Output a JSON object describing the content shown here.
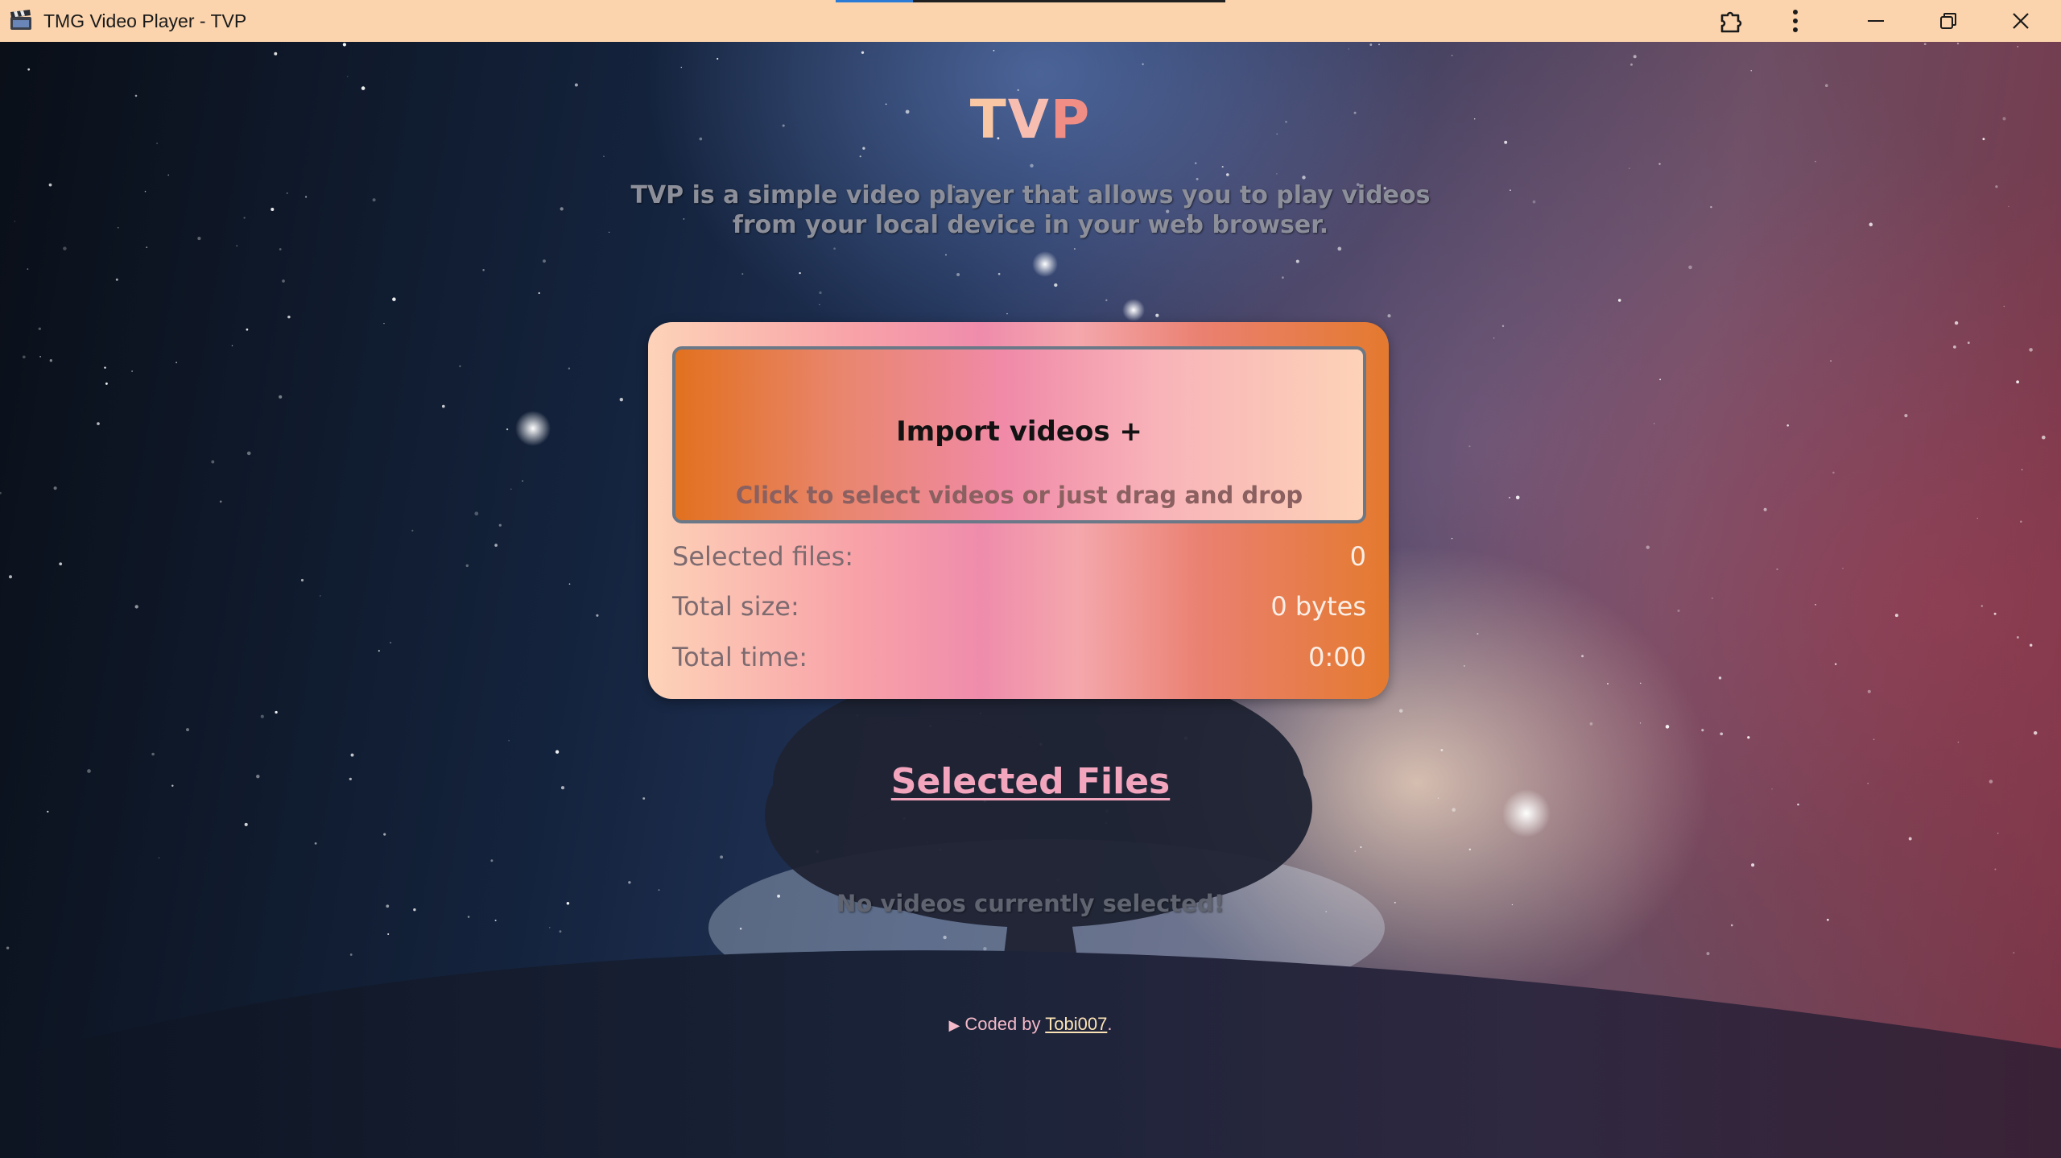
{
  "window": {
    "title": "TMG Video Player - TVP",
    "icon": "clapperboard-icon",
    "controls": [
      "extensions-icon",
      "more-vertical-icon",
      "minimize-icon",
      "restore-icon",
      "close-icon"
    ]
  },
  "header": {
    "title_parts": [
      "T",
      "V",
      "P"
    ],
    "description": "TVP is a simple video player that allows you to play videos from your local device in your web browser."
  },
  "import_card": {
    "button_label": "Import videos +",
    "hint": "Click to select videos or just drag and drop",
    "stats": [
      {
        "label": "Selected files:",
        "value": "0"
      },
      {
        "label": "Total size:",
        "value": "0 bytes"
      },
      {
        "label": "Total time:",
        "value": "0:00"
      }
    ]
  },
  "selected_files": {
    "heading": "Selected Files",
    "empty_message": "No videos currently selected!"
  },
  "footer": {
    "arrow": "▶",
    "prefix": "Coded by ",
    "author_link": "Tobi007",
    "suffix": "."
  },
  "colors": {
    "titlebar_bg": "#fbd4ad",
    "section_heading": "#f2a5bd",
    "card_orange": "#e47a2e",
    "card_pink": "#ef8cac"
  }
}
